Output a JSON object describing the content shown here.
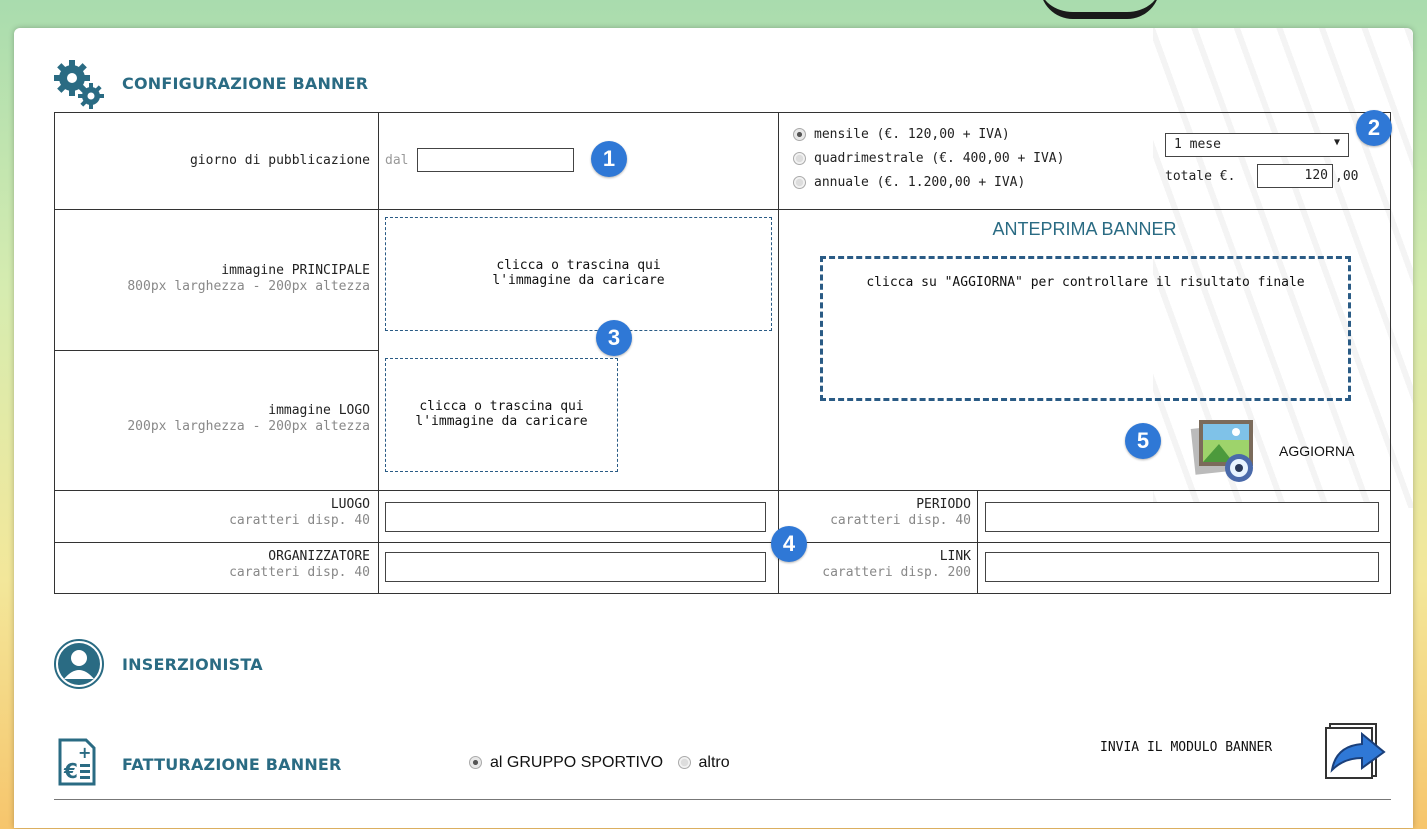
{
  "config": {
    "title": "CONFIGURAZIONE BANNER",
    "giorno_label": "giorno di pubblicazione",
    "dal_label": "dal",
    "dal_value": "",
    "options": [
      {
        "label": "mensile (€. 120,00 + IVA)",
        "checked": true
      },
      {
        "label": "quadrimestrale (€. 400,00 + IVA)",
        "checked": false
      },
      {
        "label": "annuale (€. 1.200,00 + IVA)",
        "checked": false
      }
    ],
    "duration_selected": "1 mese",
    "totale_label": "totale €.",
    "totale_value": "120",
    "totale_decimals": ",00",
    "img_principale_label": "immagine PRINCIPALE",
    "img_principale_sub": "800px larghezza - 200px altezza",
    "upload_text_1": "clicca o trascina qui",
    "upload_text_2": "l'immagine da caricare",
    "img_logo_label": "immagine LOGO",
    "img_logo_sub": "200px larghezza - 200px altezza",
    "preview_title": "ANTEPRIMA BANNER",
    "preview_text": "clicca su \"AGGIORNA\" per controllare il risultato finale",
    "aggiorna_label": "AGGIORNA",
    "luogo_label": "LUOGO",
    "luogo_sub": "caratteri disp. 40",
    "organizzatore_label": "ORGANIZZATORE",
    "organizzatore_sub": "caratteri disp. 40",
    "periodo_label": "PERIODO",
    "periodo_sub": "caratteri disp. 40",
    "link_label": "LINK",
    "link_sub": "caratteri disp. 200"
  },
  "badges": [
    "1",
    "2",
    "3",
    "4",
    "5"
  ],
  "inserzionista": {
    "title": "INSERZIONISTA"
  },
  "fatturazione": {
    "title": "FATTURAZIONE BANNER",
    "option_gruppo": "al GRUPPO SPORTIVO",
    "option_altro": "altro",
    "send_label": "INVIA IL MODULO BANNER"
  },
  "colors": {
    "accent": "#2a6b83",
    "badge": "#2f78d6",
    "dashed": "#2a5b85"
  }
}
